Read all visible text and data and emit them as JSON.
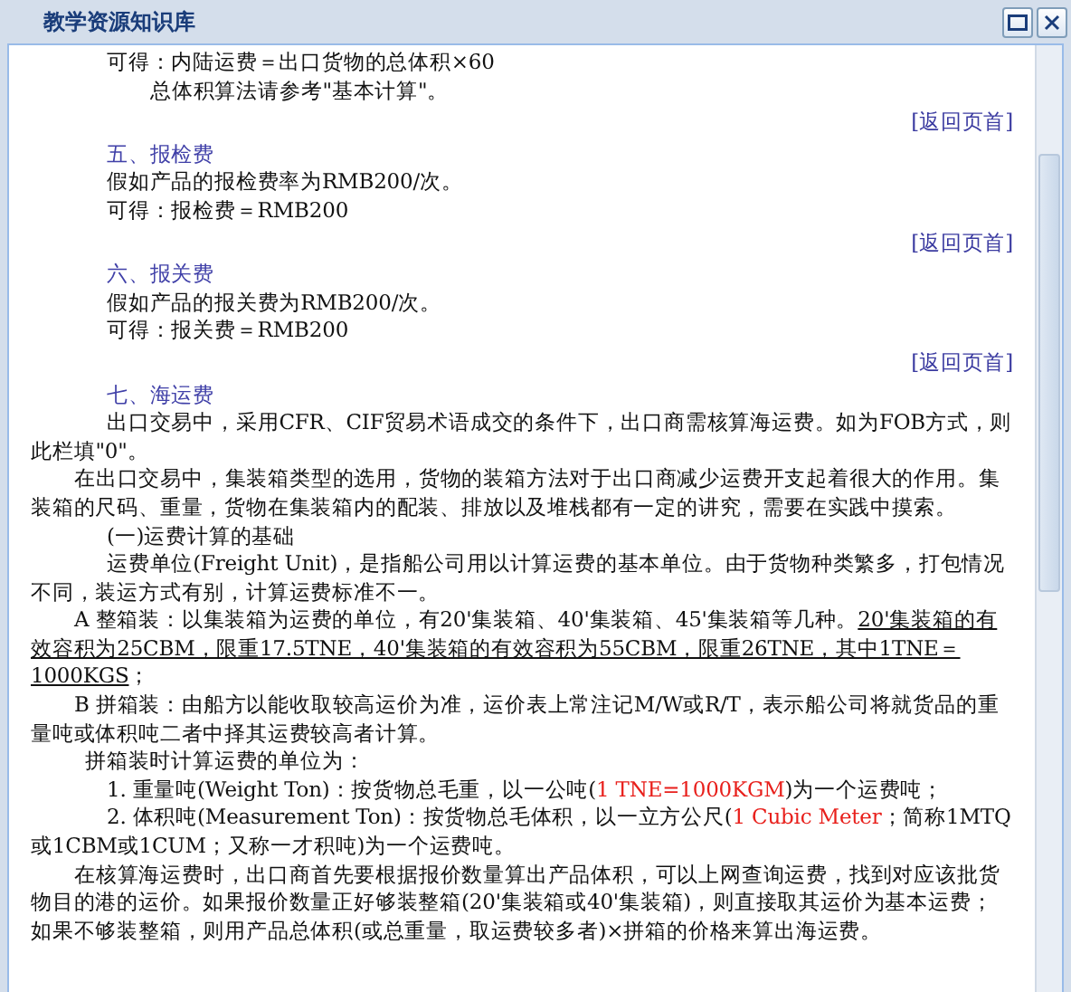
{
  "window": {
    "title": "教学资源知识库"
  },
  "content": [
    {
      "kind": "block",
      "segments": [
        {
          "text": "可得：内陆运费＝出口货物的总体积×60"
        }
      ]
    },
    {
      "kind": "deep",
      "segments": [
        {
          "text": "总体积算法请参考\"基本计算\"。"
        }
      ]
    },
    {
      "kind": "link",
      "segments": [
        {
          "text": "[返回页首]"
        }
      ]
    },
    {
      "kind": "heading",
      "segments": [
        {
          "text": "五、报检费"
        }
      ]
    },
    {
      "kind": "block",
      "segments": [
        {
          "text": "假如产品的报检费率为RMB200/次。"
        }
      ]
    },
    {
      "kind": "block",
      "segments": [
        {
          "text": "可得：报检费＝RMB200"
        }
      ]
    },
    {
      "kind": "link",
      "segments": [
        {
          "text": "[返回页首]"
        }
      ]
    },
    {
      "kind": "heading",
      "segments": [
        {
          "text": "六、报关费"
        }
      ]
    },
    {
      "kind": "block",
      "segments": [
        {
          "text": "假如产品的报关费为RMB200/次。"
        }
      ]
    },
    {
      "kind": "block",
      "segments": [
        {
          "text": "可得：报关费＝RMB200"
        }
      ]
    },
    {
      "kind": "link",
      "segments": [
        {
          "text": "[返回页首]"
        }
      ]
    },
    {
      "kind": "heading",
      "segments": [
        {
          "text": "七、海运费"
        }
      ]
    },
    {
      "kind": "body_wide",
      "segments": [
        {
          "text": "出口交易中，采用CFR、CIF贸易术语成交的条件下，出口商需核算海运费。如为FOB方式，则此栏填\"0\"。"
        }
      ]
    },
    {
      "kind": "body",
      "segments": [
        {
          "text": "在出口交易中，集装箱类型的选用，货物的装箱方法对于出口商减少运费开支起着很大的作用。集装箱的尺码、重量，货物在集装箱内的配装、排放以及堆栈都有一定的讲究，需要在实践中摸索。"
        }
      ]
    },
    {
      "kind": "block",
      "segments": [
        {
          "text": "(一)运费计算的基础"
        }
      ]
    },
    {
      "kind": "body_wide",
      "segments": [
        {
          "text": "运费单位(Freight Unit)，是指船公司用以计算运费的基本单位。由于货物种类繁多，打包情况不同，装运方式有别，计算运费标准不一。"
        }
      ]
    },
    {
      "kind": "body",
      "segments": [
        {
          "text": "A 整箱装：以集装箱为运费的单位，有20'集装箱、40'集装箱、45'集装箱等几种。"
        },
        {
          "text": "20'集装箱的有效容积为25CBM，限重17.5TNE，40'集装箱的有效容积为55CBM，限重26TNE，其中1TNE＝1000KGS",
          "kind": "underlined"
        },
        {
          "text": "；"
        }
      ]
    },
    {
      "kind": "body",
      "segments": [
        {
          "text": "B 拼箱装：由船方以能收取较高运价为准，运价表上常注记M/W或R/T，表示船公司将就货品的重量吨或体积吨二者中择其运费较高者计算。"
        }
      ]
    },
    {
      "kind": "mid",
      "segments": [
        {
          "text": "拼箱装时计算运费的单位为："
        }
      ]
    },
    {
      "kind": "list",
      "segments": [
        {
          "text": "1. 重量吨(Weight Ton)：按货物总毛重，以一公吨("
        },
        {
          "text": "1 TNE=1000KGM",
          "kind": "highlight"
        },
        {
          "text": ")为一个运费吨；"
        }
      ]
    },
    {
      "kind": "list",
      "segments": [
        {
          "text": "2. 体积吨(Measurement Ton)：按货物总毛体积，以一立方公尺("
        },
        {
          "text": "1 Cubic Meter",
          "kind": "highlight"
        },
        {
          "text": "；简称1MTQ或1CBM或1CUM；又称一才积吨)为一个运费吨。"
        }
      ]
    },
    {
      "kind": "body",
      "segments": [
        {
          "text": "在核算海运费时，出口商首先要根据报价数量算出产品体积，可以上网查询运费，找到对应该批货物目的港的运价。如果报价数量正好够装整箱(20'集装箱或40'集装箱)，则直接取其运价为基本运费；如果不够装整箱，则用产品总体积(或总重量，取运费较多者)×拼箱的价格来算出海运费。"
        }
      ]
    }
  ]
}
